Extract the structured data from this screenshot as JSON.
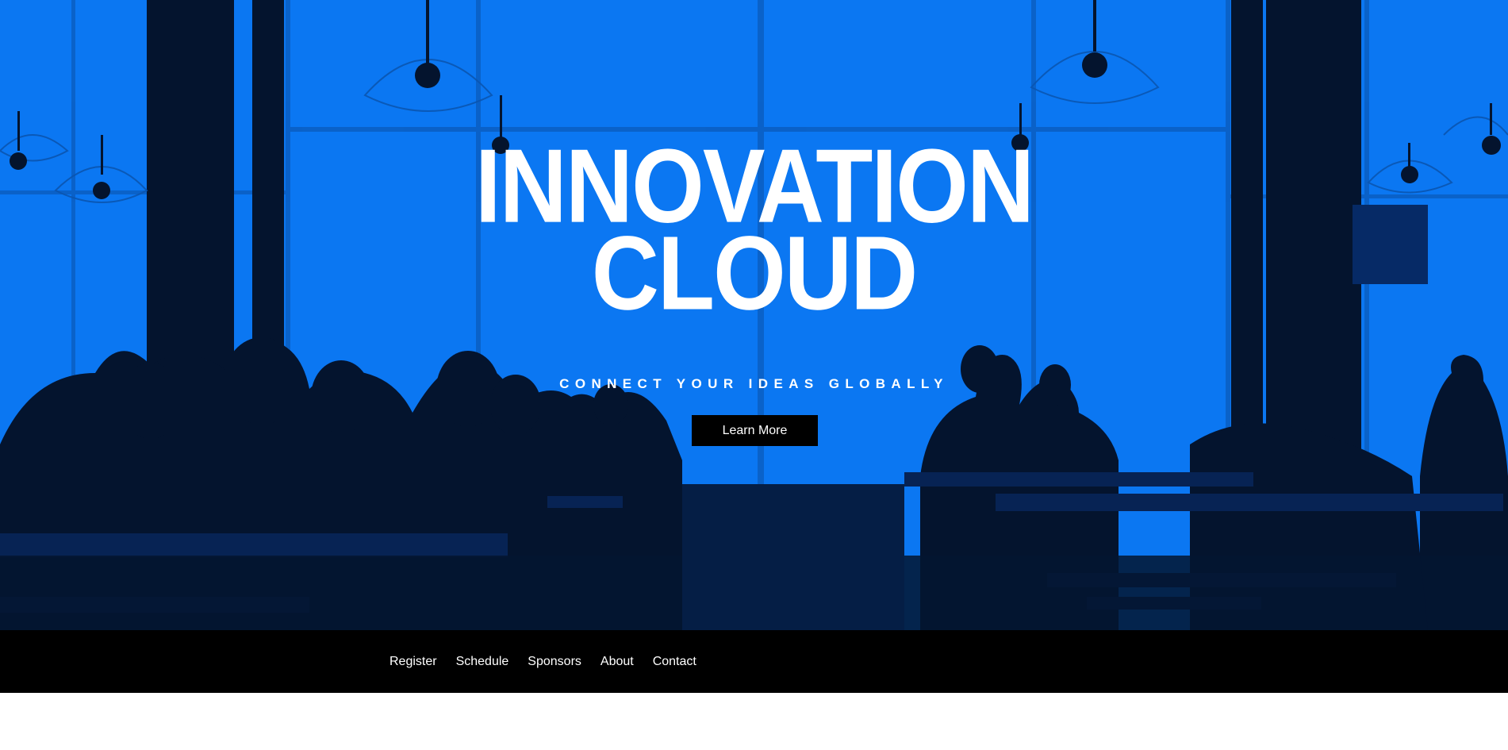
{
  "hero": {
    "title_line1": "INNOVATION",
    "title_line2": "CLOUD",
    "subtitle": "CONNECT YOUR IDEAS GLOBALLY",
    "cta_label": "Learn More",
    "background_color": "#0b77f2",
    "silhouette_color": "#04142e"
  },
  "nav": {
    "items": [
      {
        "label": "Register"
      },
      {
        "label": "Schedule"
      },
      {
        "label": "Sponsors"
      },
      {
        "label": "About"
      },
      {
        "label": "Contact"
      }
    ]
  }
}
